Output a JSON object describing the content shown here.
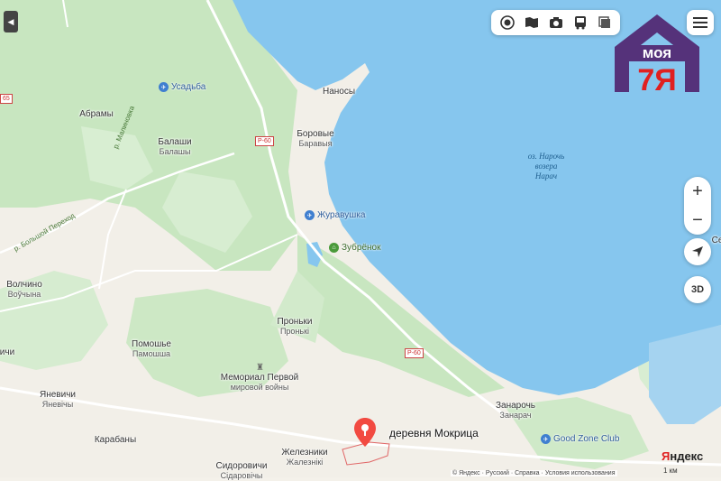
{
  "map": {
    "places": [
      {
        "name": "Абрамы"
      },
      {
        "name": "Балаши",
        "sub": "Балашы"
      },
      {
        "name": "Наносы"
      },
      {
        "name": "Боровые",
        "sub": "Баравыя"
      },
      {
        "name": "Волчино",
        "sub": "Воўчына"
      },
      {
        "name": "Помошье",
        "sub": "Памошша"
      },
      {
        "name": "Проньки",
        "sub": "Пронькі"
      },
      {
        "name": "Яневичи",
        "sub": "Яневічы"
      },
      {
        "name": "Карабаны"
      },
      {
        "name": "Железники",
        "sub": "Жалезнікі"
      },
      {
        "name": "Сидоровичи",
        "sub": "Сідаровічы"
      },
      {
        "name": "Занарочь",
        "sub": "Занарач"
      },
      {
        "name": "Мемориал Первой",
        "sub": "мировой войны"
      },
      {
        "name": "ичи"
      }
    ],
    "lake": {
      "line1": "оз. Нарочь",
      "line2": "возера",
      "line3": "Нарач"
    },
    "pois": [
      {
        "name": "Усадьба"
      },
      {
        "name": "Журавушка"
      },
      {
        "name": "Зубрёнок"
      },
      {
        "name": "Good Zone Club"
      }
    ],
    "roads": [
      {
        "label": "р. Малиновка"
      },
      {
        "label": "р. Большой Переход"
      }
    ],
    "shields": [
      "Р-60",
      "Р-60",
      "65"
    ],
    "selected_place": "деревня Мокрица",
    "edge_label": "Се"
  },
  "colors": {
    "water": "#86c6ee",
    "forest": "#c9e6c2",
    "road": "#ffffff",
    "pin": "#f24a41",
    "logo": "#55327a"
  },
  "toolbar": {
    "icons": [
      "layers-icon",
      "panorama-icon",
      "camera-icon",
      "bus-icon",
      "copy-icon"
    ]
  },
  "controls": {
    "zoom_in": "+",
    "zoom_out": "−",
    "view3d": "3D",
    "locate_icon": "arrow-icon"
  },
  "overlay_logo": {
    "line1": "моя",
    "line2": "7Я"
  },
  "brand": {
    "text1": "Я",
    "text2": "ндекс"
  },
  "footer": {
    "copyright": "© Яндекс",
    "lang": "Русский",
    "help": "Справка",
    "terms": "Условия использования",
    "scale": "1 км"
  }
}
